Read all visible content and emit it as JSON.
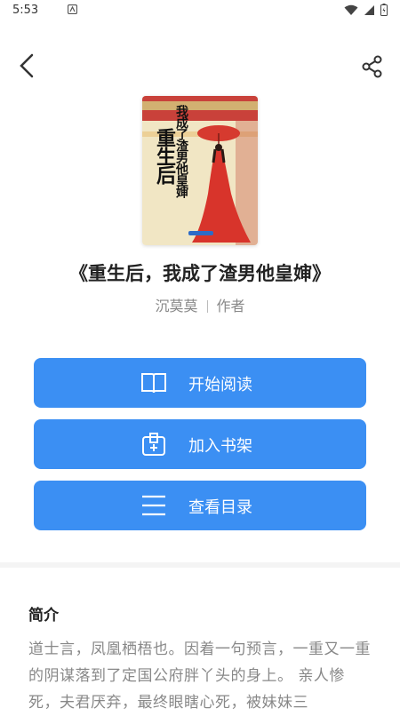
{
  "status_bar": {
    "time": "5:53"
  },
  "topbar": {
    "back_icon": "chevron-left-icon",
    "share_icon": "share-icon"
  },
  "book": {
    "cover_title_big": "重生后",
    "cover_title_small": "我成了渣男他皇婶",
    "title": "《重生后，我成了渣男他皇婶》",
    "author": "沉莫莫",
    "author_role": "作者"
  },
  "actions": {
    "read_label": "开始阅读",
    "shelf_label": "加入书架",
    "toc_label": "查看目录"
  },
  "intro": {
    "heading": "简介",
    "text": "道士言，凤凰栖梧也。因着一句预言，一重又一重的阴谋落到了定国公府胖丫头的身上。 亲人惨死，夫君厌弃，最终眼瞎心死，被妹妹三"
  },
  "colors": {
    "accent": "#3b8ff3"
  }
}
